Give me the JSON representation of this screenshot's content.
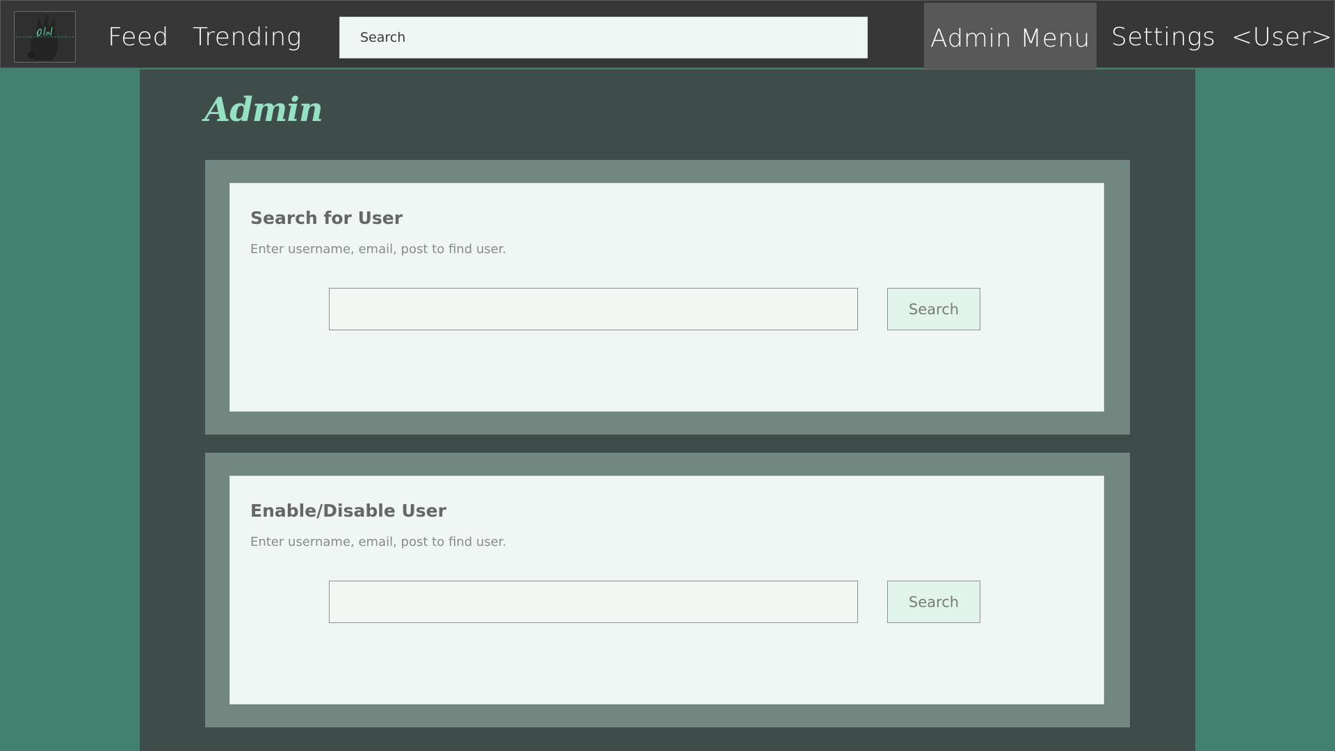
{
  "header": {
    "nav": {
      "feed": "Feed",
      "trending": "Trending",
      "admin_menu": "Admin Menu",
      "settings": "Settings",
      "user": "<User>"
    },
    "search": {
      "placeholder": "Search",
      "value": ""
    },
    "logo_icon": "brand-logo"
  },
  "main": {
    "title": "Admin",
    "cards": [
      {
        "title": "Search for User",
        "description": "Enter username, email, post to find user.",
        "input_value": "",
        "button_label": "Search"
      },
      {
        "title": "Enable/Disable User",
        "description": "Enter username, email, post to find user.",
        "input_value": "",
        "button_label": "Search"
      }
    ]
  },
  "colors": {
    "background": "#428070",
    "topbar": "#373737",
    "active_nav": "#585858",
    "panel": "#3e4d4a",
    "card_outer": "#71877f",
    "card_inner": "#f0f6f3",
    "accent": "#96e0c4",
    "button": "#e1f4ec"
  }
}
